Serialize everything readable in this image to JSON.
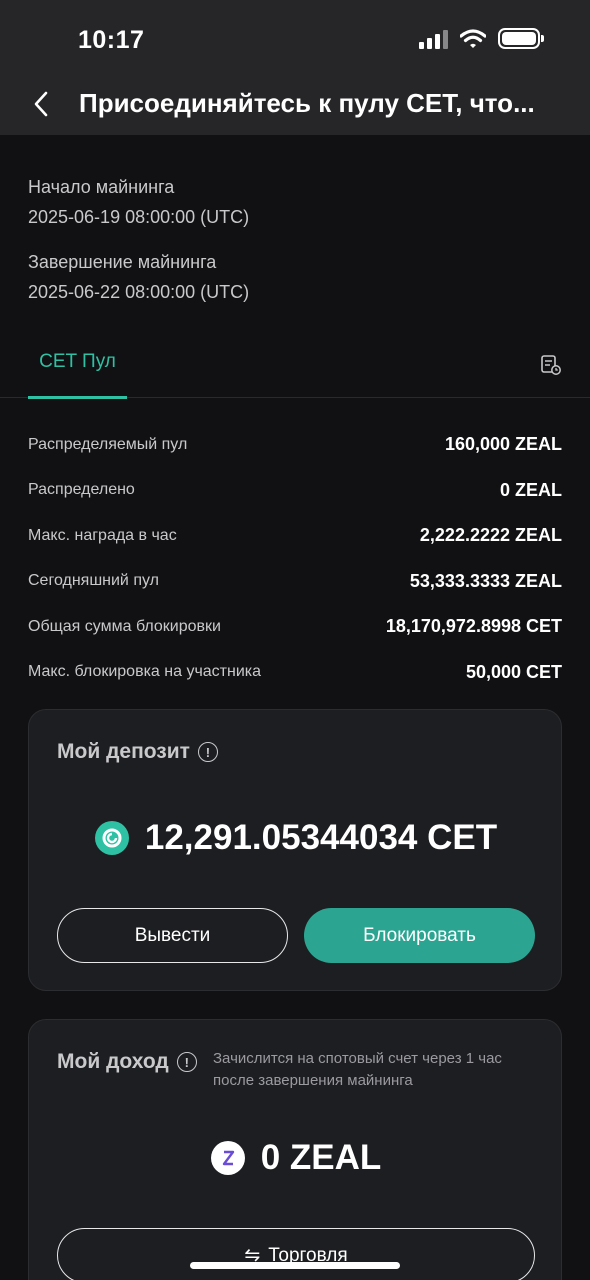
{
  "status": {
    "time": "10:17"
  },
  "header": {
    "title": "Присоединяйтесь к пулу CET, что..."
  },
  "mining": {
    "start_label": "Начало майнинга",
    "start_value": "2025-06-19 08:00:00 (UTC)",
    "end_label": "Завершение майнинга",
    "end_value": "2025-06-22 08:00:00 (UTC)"
  },
  "tabs": [
    {
      "label": "CET Пул"
    }
  ],
  "stats": [
    {
      "label": "Распределяемый пул",
      "value": "160,000 ZEAL"
    },
    {
      "label": "Распределено",
      "value": "0 ZEAL"
    },
    {
      "label": "Макс. награда в час",
      "value": "2,222.2222 ZEAL"
    },
    {
      "label": "Сегодняшний пул",
      "value": "53,333.3333 ZEAL"
    },
    {
      "label": "Общая сумма блокировки",
      "value": "18,170,972.8998 CET"
    },
    {
      "label": "Макс. блокировка на участника",
      "value": "50,000 CET"
    }
  ],
  "deposit": {
    "title": "Мой депозит",
    "amount": "12,291.05344034 CET",
    "withdraw_label": "Вывести",
    "lock_label": "Блокировать"
  },
  "income": {
    "title": "Мой доход",
    "note": "Зачислится на спотовый счет через 1 час после завершения майнинга",
    "amount": "0 ZEAL",
    "trade_label": "Торговля"
  },
  "colors": {
    "accent": "#2fc1a3",
    "button": "#2ba592",
    "background": "#111113",
    "card": "#1d1e21"
  },
  "icons": {
    "back": "chevron-left-icon",
    "record": "record-list-icon",
    "info": "info-icon",
    "cet": "cet-coin-icon",
    "zeal": "zeal-coin-icon",
    "trade": "swap-arrows-icon"
  }
}
